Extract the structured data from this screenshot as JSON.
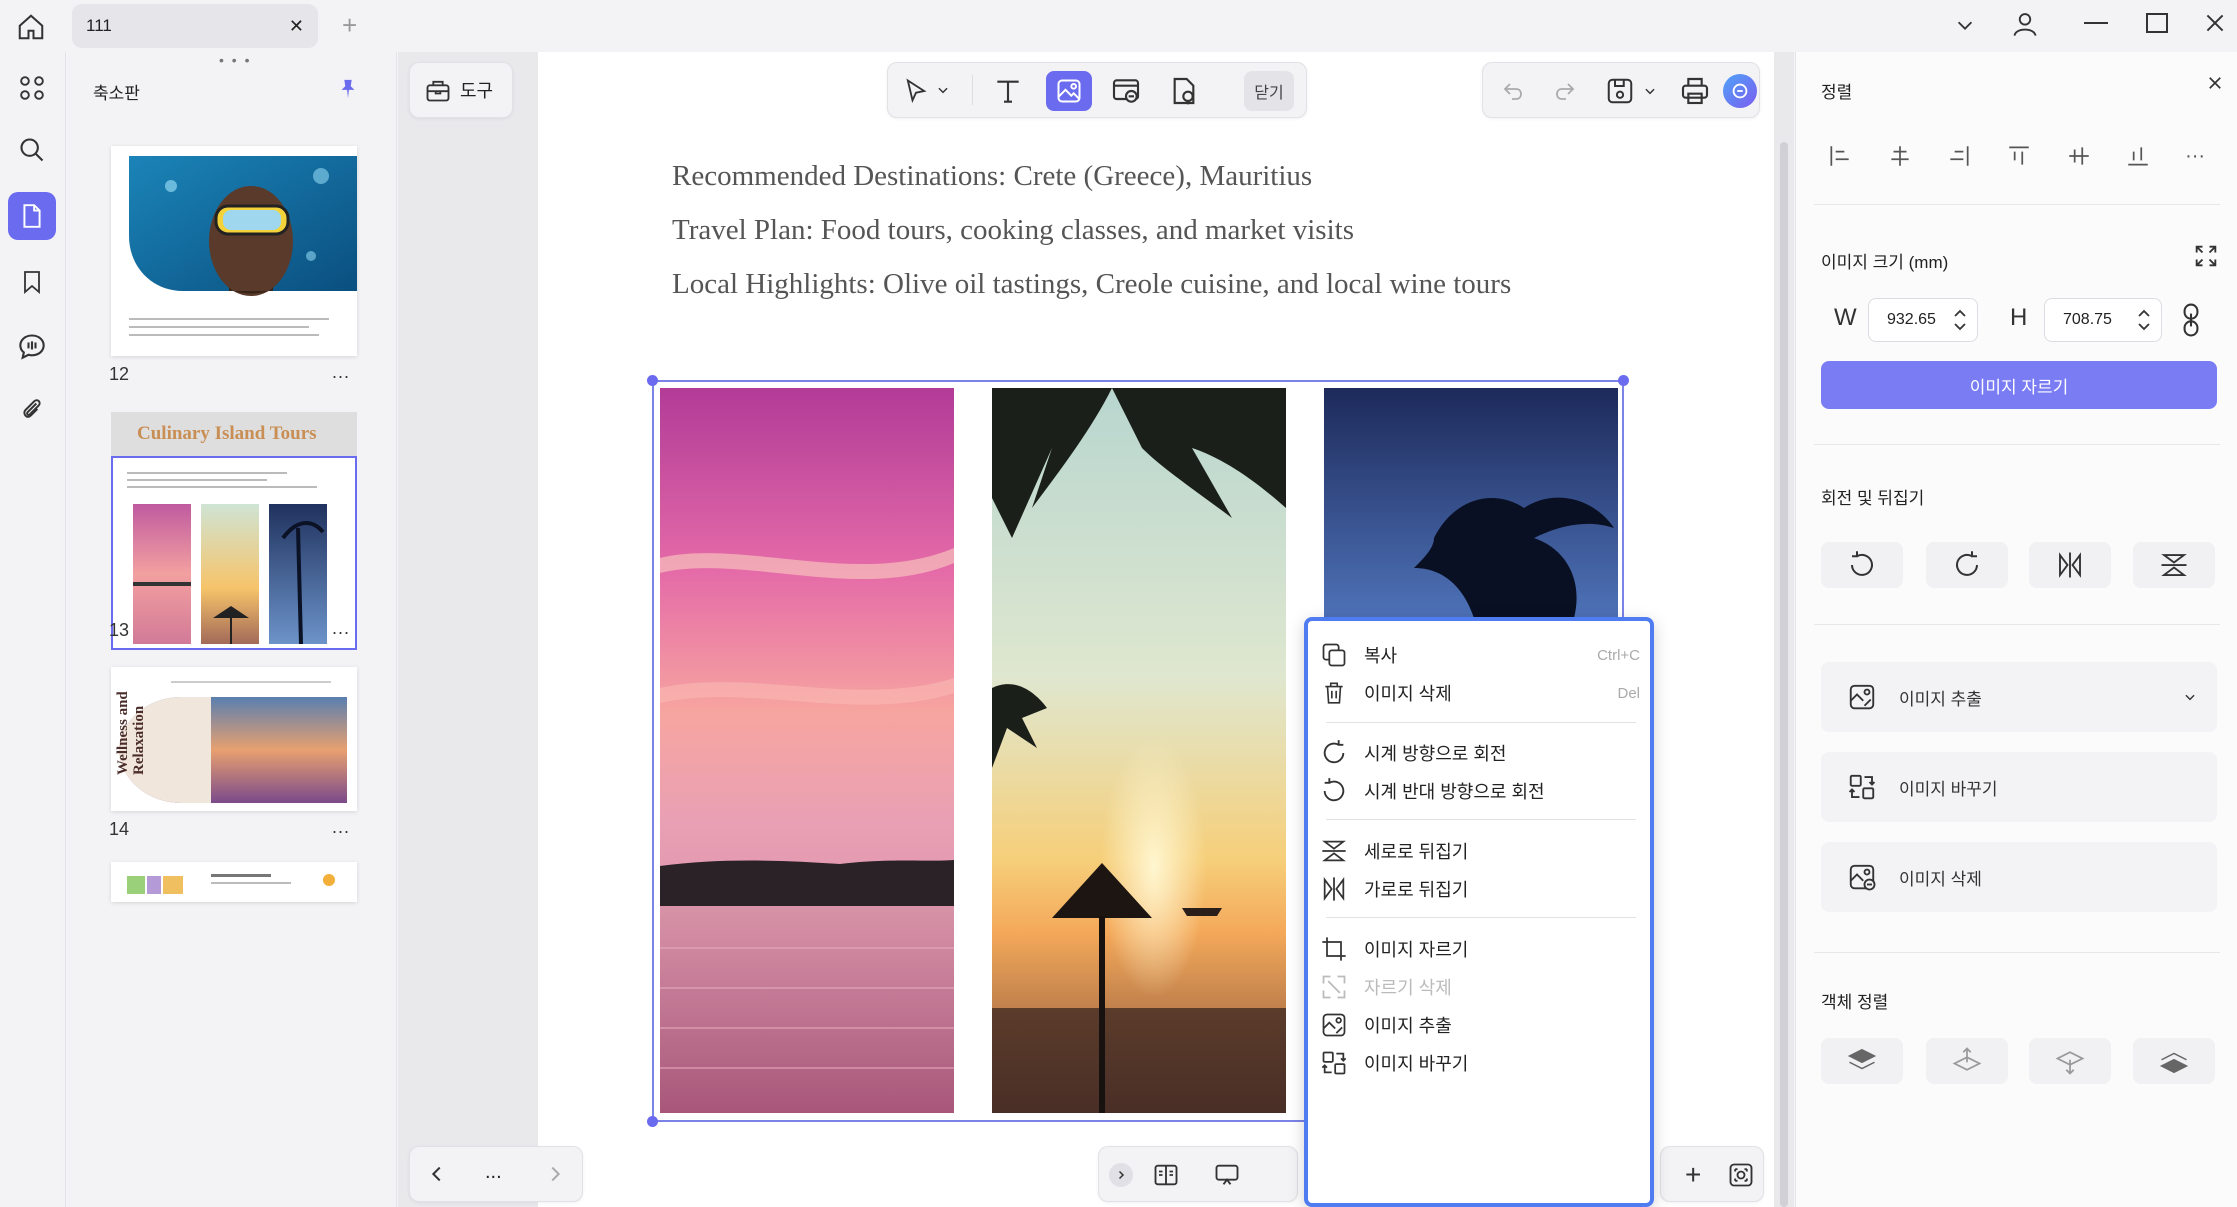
{
  "titlebar": {
    "tab_title": "111",
    "close_tab": "✕",
    "new_tab": "+"
  },
  "thumbnail_panel": {
    "title": "축소판",
    "pages": [
      {
        "number": "12",
        "more": "..."
      },
      {
        "number": "13",
        "more": "...",
        "heading": "Culinary Island Tours"
      },
      {
        "number": "14",
        "more": "...",
        "heading": "Wellness and Relaxation"
      }
    ]
  },
  "toolbar": {
    "tools_label": "도구",
    "close_label": "닫기"
  },
  "document": {
    "lines": [
      "Recommended Destinations: Crete (Greece), Mauritius",
      "Travel Plan: Food tours, cooking classes, and market visits",
      "Local Highlights: Olive oil tastings, Creole cuisine, and local wine tours"
    ]
  },
  "bottom_nav": {
    "more": "...",
    "plus": "+"
  },
  "context_menu": {
    "items": [
      {
        "label": "복사",
        "shortcut": "Ctrl+C",
        "icon": "copy-icon"
      },
      {
        "label": "이미지 삭제",
        "shortcut": "Del",
        "icon": "trash-icon"
      },
      {
        "label": "시계 방향으로 회전",
        "shortcut": "",
        "icon": "rotate-cw-icon"
      },
      {
        "label": "시계 반대 방향으로 회전",
        "shortcut": "",
        "icon": "rotate-ccw-icon"
      },
      {
        "label": "세로로 뒤집기",
        "shortcut": "",
        "icon": "flip-vertical-icon"
      },
      {
        "label": "가로로 뒤집기",
        "shortcut": "",
        "icon": "flip-horizontal-icon"
      },
      {
        "label": "이미지 자르기",
        "shortcut": "",
        "icon": "crop-icon"
      },
      {
        "label": "자르기 삭제",
        "shortcut": "",
        "icon": "remove-crop-icon",
        "disabled": true
      },
      {
        "label": "이미지 추출",
        "shortcut": "",
        "icon": "extract-image-icon"
      },
      {
        "label": "이미지 바꾸기",
        "shortcut": "",
        "icon": "replace-image-icon"
      }
    ]
  },
  "right_panel": {
    "align_title": "정렬",
    "size_title": "이미지 크기 (mm)",
    "width_label": "W",
    "width_value": "932.65",
    "height_label": "H",
    "height_value": "708.75",
    "crop_button": "이미지 자르기",
    "rotate_title": "회전 및 뒤집기",
    "extract_label": "이미지 추출",
    "replace_label": "이미지 바꾸기",
    "delete_label": "이미지 삭제",
    "arrange_title": "객체 정렬"
  },
  "colors": {
    "accent": "#6b6bf0",
    "menu_border": "#4f7cf0",
    "selection": "#7b82e8"
  }
}
